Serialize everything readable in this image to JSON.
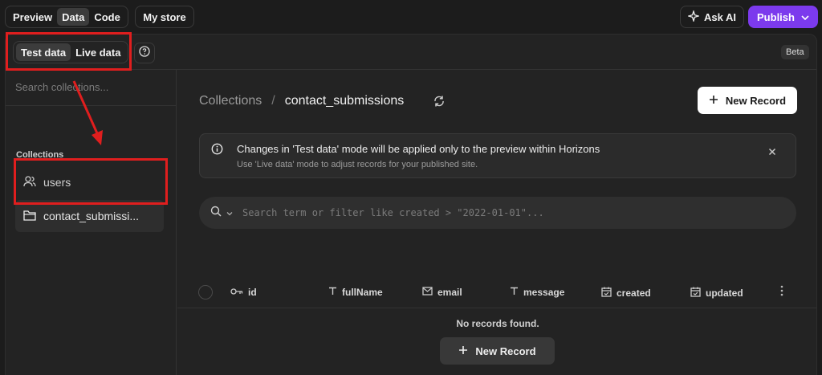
{
  "topbar": {
    "mode_tabs": [
      {
        "label": "Preview",
        "active": false
      },
      {
        "label": "Data",
        "active": true
      },
      {
        "label": "Code",
        "active": false
      }
    ],
    "store_label": "My store",
    "ask_ai_label": "Ask AI",
    "publish_label": "Publish"
  },
  "subbar": {
    "data_tabs": [
      {
        "label": "Test data",
        "active": true
      },
      {
        "label": "Live data",
        "active": false
      }
    ],
    "help_icon": "help-circle-icon",
    "beta_label": "Beta"
  },
  "sidebar": {
    "search_placeholder": "Search collections...",
    "section_title": "Collections",
    "items": [
      {
        "label": "users",
        "icon": "users-icon",
        "selected": false
      },
      {
        "label": "contact_submissi...",
        "icon": "folder-icon",
        "selected": true
      }
    ]
  },
  "main": {
    "breadcrumb_root": "Collections",
    "breadcrumb_sep": "/",
    "breadcrumb_current": "contact_submissions",
    "new_record_label": "New Record",
    "notice": {
      "title": "Changes in 'Test data' mode will be applied only to the preview within Horizons",
      "subtitle": "Use 'Live data' mode to adjust records for your published site."
    },
    "filter_placeholder": "Search term or filter like created > \"2022-01-01\"...",
    "columns": [
      {
        "label": "id",
        "icon": "key-icon"
      },
      {
        "label": "fullName",
        "icon": "text-icon"
      },
      {
        "label": "email",
        "icon": "mail-icon"
      },
      {
        "label": "message",
        "icon": "text-icon"
      },
      {
        "label": "created",
        "icon": "calendar-icon"
      },
      {
        "label": "updated",
        "icon": "calendar-icon"
      }
    ],
    "empty_message": "No records found.",
    "empty_new_record_label": "New Record"
  },
  "colors": {
    "background": "#1c1c1c",
    "panel": "#232323",
    "accent": "#7c3aed",
    "annotation": "#e01e1e"
  }
}
